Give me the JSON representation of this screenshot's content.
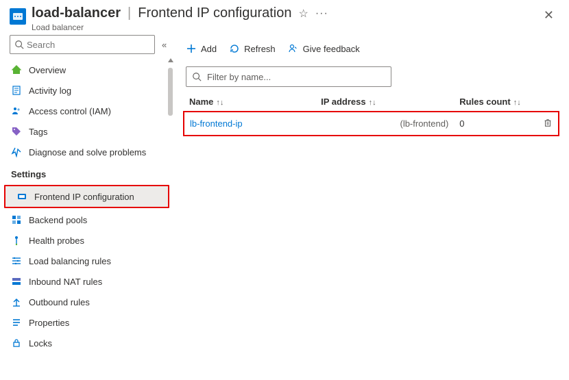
{
  "header": {
    "resource_name": "load-balancer",
    "blade_title": "Frontend IP configuration",
    "subtitle": "Load balancer",
    "separator": "|"
  },
  "sidebar": {
    "search_placeholder": "Search",
    "items": [
      {
        "label": "Overview",
        "icon": "overview"
      },
      {
        "label": "Activity log",
        "icon": "activity"
      },
      {
        "label": "Access control (IAM)",
        "icon": "iam"
      },
      {
        "label": "Tags",
        "icon": "tags"
      },
      {
        "label": "Diagnose and solve problems",
        "icon": "diagnose"
      }
    ],
    "settings_label": "Settings",
    "settings_items": [
      {
        "label": "Frontend IP configuration",
        "icon": "frontend",
        "active": true,
        "highlight": true
      },
      {
        "label": "Backend pools",
        "icon": "backend"
      },
      {
        "label": "Health probes",
        "icon": "probes"
      },
      {
        "label": "Load balancing rules",
        "icon": "lbrules"
      },
      {
        "label": "Inbound NAT rules",
        "icon": "nat"
      },
      {
        "label": "Outbound rules",
        "icon": "outbound"
      },
      {
        "label": "Properties",
        "icon": "properties"
      },
      {
        "label": "Locks",
        "icon": "locks"
      }
    ]
  },
  "toolbar": {
    "add_label": "Add",
    "refresh_label": "Refresh",
    "feedback_label": "Give feedback"
  },
  "filter": {
    "placeholder": "Filter by name..."
  },
  "table": {
    "cols": {
      "name": "Name",
      "ip": "IP address",
      "rules": "Rules count"
    },
    "rows": [
      {
        "name": "lb-frontend-ip",
        "ip_sub": "(lb-frontend)",
        "rules": "0"
      }
    ]
  }
}
